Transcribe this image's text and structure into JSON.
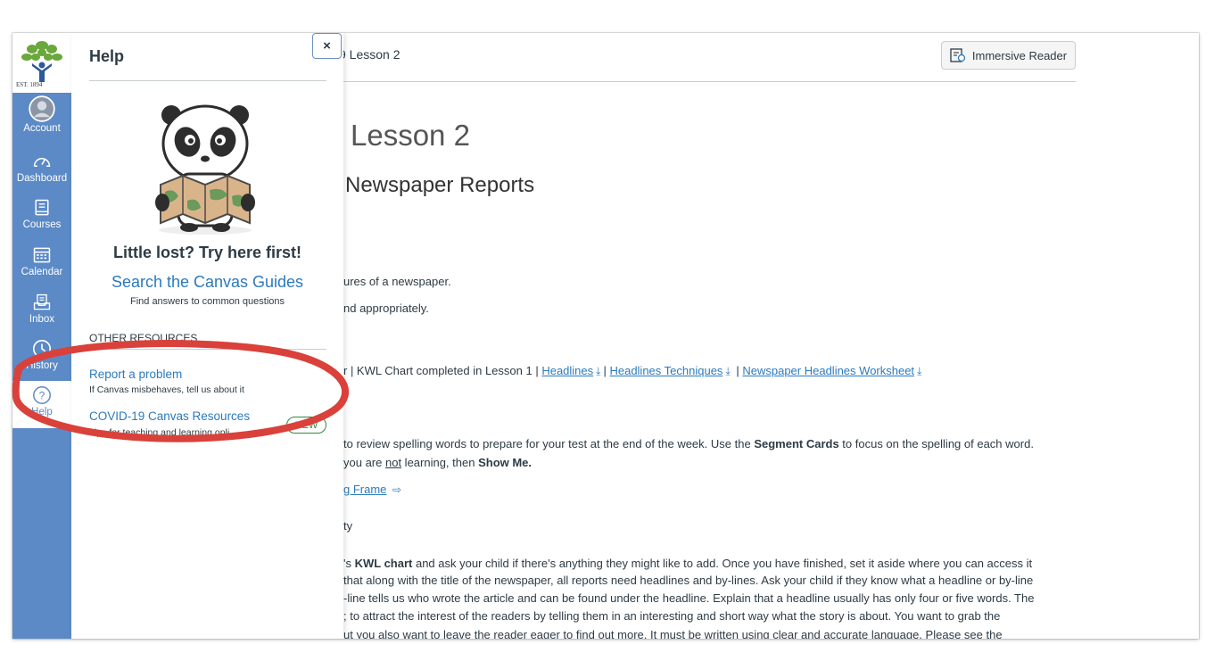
{
  "nav": {
    "logo_text": "EST. 1894",
    "items": [
      {
        "label": "Account"
      },
      {
        "label": "Dashboard"
      },
      {
        "label": "Courses"
      },
      {
        "label": "Calendar"
      },
      {
        "label": "Inbox"
      },
      {
        "label": "History"
      },
      {
        "label": "Help"
      }
    ]
  },
  "header": {
    "breadcrumb": "9 Lesson 2",
    "immersive_reader": "Immersive Reader"
  },
  "page": {
    "title": "Lesson 2",
    "subtitle": "Newspaper Reports",
    "line1": "ures of a newspaper.",
    "line2": "nd appropriately.",
    "materials_prefix": "r | KWL Chart completed in Lesson 1 |",
    "link_headlines": "Headlines",
    "link_techniques": "Headlines Techniques",
    "link_worksheet": "Newspaper Headlines Worksheet",
    "spelling_pre": "to review spelling words to prepare for your test at the end of the week. Use the ",
    "spelling_bold": "Segment Cards",
    "spelling_post": " to focus on the spelling of each word.",
    "showme_pre": "you are ",
    "showme_u": "not",
    "showme_mid": " learning, then ",
    "showme_bold": "Show Me.",
    "frame_link": "g Frame",
    "activity": "ty",
    "kwl_pre": "'s ",
    "kwl_bold": "KWL chart",
    "kwl_post": " and ask your child if there's anything they might like to add. Once you have finished, set it aside where you can access it",
    "body_l2": "that along with the title of the newspaper, all reports need headlines and by-lines. Ask your child if they know what a headline or by-line",
    "body_l3": "-line tells us who wrote the article and can be found under the headline. Explain that a headline usually has only four or five words.  The",
    "body_l4": "; to attract the interest of the readers by telling them in an interesting and short way what the story is about. You want to grab the",
    "body_l5": "ut you also want to leave the reader eager to find out more. It must be written using clear and accurate language. Please see the"
  },
  "help": {
    "title": "Help",
    "close": "×",
    "lost": "Little lost? Try here first!",
    "guides": "Search the Canvas Guides",
    "guides_sub": "Find answers to common questions",
    "other": "OTHER RESOURCES",
    "report": "Report a problem",
    "report_sub": "If Canvas misbehaves, tell us about it",
    "covid": "COVID-19 Canvas Resources",
    "covid_sub": "Tips for teaching and learning onli",
    "new_badge": "NEW"
  },
  "colors": {
    "nav": "#5b8ac6",
    "link": "#2b7abc",
    "annotation": "#d9413a",
    "badge": "#2b8a3e"
  }
}
